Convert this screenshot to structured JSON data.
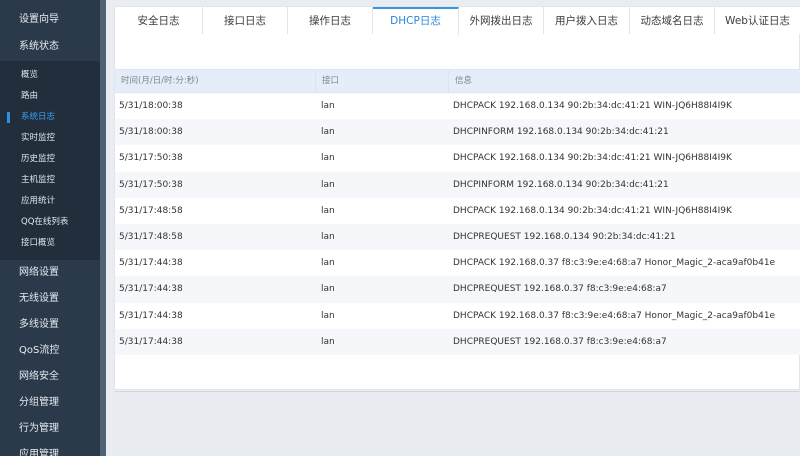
{
  "sidebar": {
    "top_items": [
      {
        "label": "设置向导"
      },
      {
        "label": "系统状态"
      }
    ],
    "sub_items": [
      {
        "label": "概览"
      },
      {
        "label": "路由"
      },
      {
        "label": "系统日志",
        "active": true
      },
      {
        "label": "实时监控"
      },
      {
        "label": "历史监控"
      },
      {
        "label": "主机监控"
      },
      {
        "label": "应用统计"
      },
      {
        "label": "QQ在线列表"
      },
      {
        "label": "接口概览"
      }
    ],
    "bottom_items": [
      {
        "label": "网络设置"
      },
      {
        "label": "无线设置"
      },
      {
        "label": "多线设置"
      },
      {
        "label": "QoS流控"
      },
      {
        "label": "网络安全"
      },
      {
        "label": "分组管理"
      },
      {
        "label": "行为管理"
      },
      {
        "label": "应用管理"
      }
    ]
  },
  "tabs": [
    {
      "label": "安全日志"
    },
    {
      "label": "接口日志"
    },
    {
      "label": "操作日志"
    },
    {
      "label": "DHCP日志",
      "active": true
    },
    {
      "label": "外网拨出日志"
    },
    {
      "label": "用户拨入日志"
    },
    {
      "label": "动态域名日志"
    },
    {
      "label": "Web认证日志"
    }
  ],
  "table": {
    "headers": [
      "时间(月/日/时:分:秒)",
      "接口",
      "信息"
    ],
    "rows": [
      {
        "time": "5/31/18:00:38",
        "iface": "lan",
        "info": "DHCPACK 192.168.0.134 90:2b:34:dc:41:21 WIN-JQ6H88I4I9K"
      },
      {
        "time": "5/31/18:00:38",
        "iface": "lan",
        "info": "DHCPINFORM 192.168.0.134 90:2b:34:dc:41:21"
      },
      {
        "time": "5/31/17:50:38",
        "iface": "lan",
        "info": "DHCPACK 192.168.0.134 90:2b:34:dc:41:21 WIN-JQ6H88I4I9K"
      },
      {
        "time": "5/31/17:50:38",
        "iface": "lan",
        "info": "DHCPINFORM 192.168.0.134 90:2b:34:dc:41:21"
      },
      {
        "time": "5/31/17:48:58",
        "iface": "lan",
        "info": "DHCPACK 192.168.0.134 90:2b:34:dc:41:21 WIN-JQ6H88I4I9K"
      },
      {
        "time": "5/31/17:48:58",
        "iface": "lan",
        "info": "DHCPREQUEST 192.168.0.134 90:2b:34:dc:41:21"
      },
      {
        "time": "5/31/17:44:38",
        "iface": "lan",
        "info": "DHCPACK 192.168.0.37 f8:c3:9e:e4:68:a7 Honor_Magic_2-aca9af0b41e"
      },
      {
        "time": "5/31/17:44:38",
        "iface": "lan",
        "info": "DHCPREQUEST 192.168.0.37 f8:c3:9e:e4:68:a7"
      },
      {
        "time": "5/31/17:44:38",
        "iface": "lan",
        "info": "DHCPACK 192.168.0.37 f8:c3:9e:e4:68:a7 Honor_Magic_2-aca9af0b41e"
      },
      {
        "time": "5/31/17:44:38",
        "iface": "lan",
        "info": "DHCPREQUEST 192.168.0.37 f8:c3:9e:e4:68:a7"
      }
    ]
  }
}
